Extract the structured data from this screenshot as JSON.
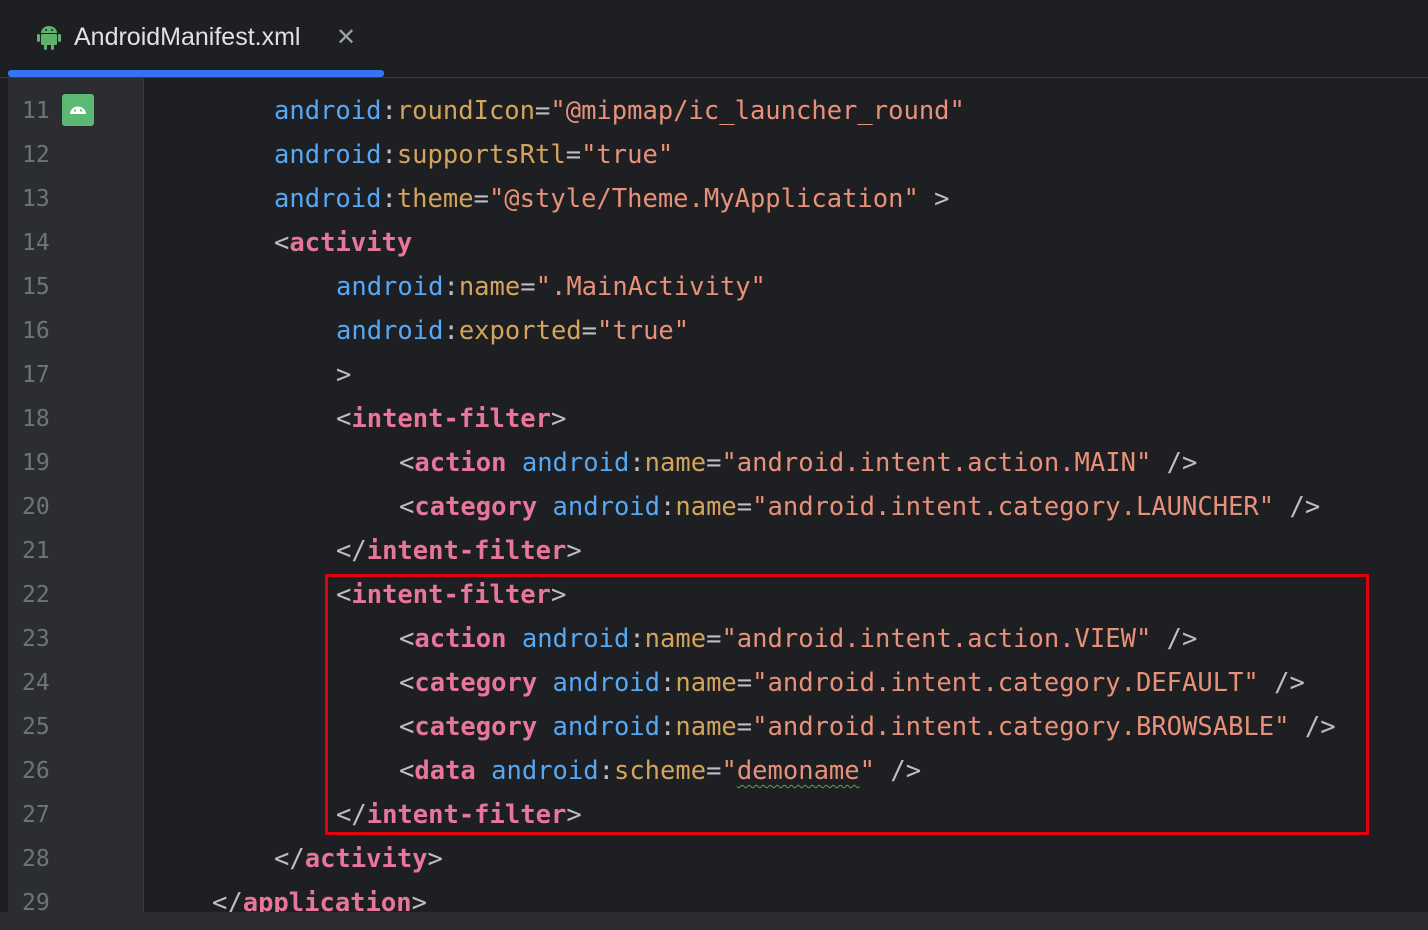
{
  "tab": {
    "title": "AndroidManifest.xml",
    "close_glyph": "✕",
    "icon": "android-icon"
  },
  "colors": {
    "namespace": "#56a8f5",
    "attribute": "#d3a45c",
    "string": "#e8917a",
    "tag": "#e8769b",
    "punctuation": "#bcbec4",
    "highlight_box": "#e00010"
  },
  "lines": [
    {
      "num": "11",
      "indent": 2,
      "tokens": [
        [
          "ns",
          "android"
        ],
        [
          "pu",
          ":"
        ],
        [
          "at",
          "roundIcon"
        ],
        [
          "pu",
          "="
        ],
        [
          "st",
          "\"@mipmap/ic_launcher_round\""
        ]
      ]
    },
    {
      "num": "12",
      "indent": 2,
      "tokens": [
        [
          "ns",
          "android"
        ],
        [
          "pu",
          ":"
        ],
        [
          "at",
          "supportsRtl"
        ],
        [
          "pu",
          "="
        ],
        [
          "st",
          "\"true\""
        ]
      ]
    },
    {
      "num": "13",
      "indent": 2,
      "tokens": [
        [
          "ns",
          "android"
        ],
        [
          "pu",
          ":"
        ],
        [
          "at",
          "theme"
        ],
        [
          "pu",
          "="
        ],
        [
          "st",
          "\"@style/Theme.MyApplication\""
        ],
        [
          "pu",
          " >"
        ]
      ]
    },
    {
      "num": "14",
      "indent": 2,
      "tokens": [
        [
          "pu",
          "<"
        ],
        [
          "tn",
          "activity"
        ]
      ]
    },
    {
      "num": "15",
      "indent": 3,
      "tokens": [
        [
          "ns",
          "android"
        ],
        [
          "pu",
          ":"
        ],
        [
          "at",
          "name"
        ],
        [
          "pu",
          "="
        ],
        [
          "st",
          "\".MainActivity\""
        ]
      ]
    },
    {
      "num": "16",
      "indent": 3,
      "tokens": [
        [
          "ns",
          "android"
        ],
        [
          "pu",
          ":"
        ],
        [
          "at",
          "exported"
        ],
        [
          "pu",
          "="
        ],
        [
          "st",
          "\"true\""
        ]
      ]
    },
    {
      "num": "17",
      "indent": 3,
      "tokens": [
        [
          "pu",
          ">"
        ]
      ]
    },
    {
      "num": "18",
      "indent": 3,
      "tokens": [
        [
          "pu",
          "<"
        ],
        [
          "tn",
          "intent-filter"
        ],
        [
          "pu",
          ">"
        ]
      ]
    },
    {
      "num": "19",
      "indent": 4,
      "tokens": [
        [
          "pu",
          "<"
        ],
        [
          "tn",
          "action"
        ],
        [
          "pu",
          " "
        ],
        [
          "ns",
          "android"
        ],
        [
          "pu",
          ":"
        ],
        [
          "at",
          "name"
        ],
        [
          "pu",
          "="
        ],
        [
          "st",
          "\"android.intent.action.MAIN\""
        ],
        [
          "pu",
          " />"
        ]
      ]
    },
    {
      "num": "20",
      "indent": 4,
      "tokens": [
        [
          "pu",
          "<"
        ],
        [
          "tn",
          "category"
        ],
        [
          "pu",
          " "
        ],
        [
          "ns",
          "android"
        ],
        [
          "pu",
          ":"
        ],
        [
          "at",
          "name"
        ],
        [
          "pu",
          "="
        ],
        [
          "st",
          "\"android.intent.category.LAUNCHER\""
        ],
        [
          "pu",
          " />"
        ]
      ]
    },
    {
      "num": "21",
      "indent": 3,
      "tokens": [
        [
          "pu",
          "</"
        ],
        [
          "tn",
          "intent-filter"
        ],
        [
          "pu",
          ">"
        ]
      ]
    },
    {
      "num": "22",
      "indent": 3,
      "tokens": [
        [
          "pu",
          "<"
        ],
        [
          "tn",
          "intent-filter"
        ],
        [
          "pu",
          ">"
        ]
      ]
    },
    {
      "num": "23",
      "indent": 4,
      "tokens": [
        [
          "pu",
          "<"
        ],
        [
          "tn",
          "action"
        ],
        [
          "pu",
          " "
        ],
        [
          "ns",
          "android"
        ],
        [
          "pu",
          ":"
        ],
        [
          "at",
          "name"
        ],
        [
          "pu",
          "="
        ],
        [
          "st",
          "\"android.intent.action.VIEW\""
        ],
        [
          "pu",
          " />"
        ]
      ]
    },
    {
      "num": "24",
      "indent": 4,
      "tokens": [
        [
          "pu",
          "<"
        ],
        [
          "tn",
          "category"
        ],
        [
          "pu",
          " "
        ],
        [
          "ns",
          "android"
        ],
        [
          "pu",
          ":"
        ],
        [
          "at",
          "name"
        ],
        [
          "pu",
          "="
        ],
        [
          "st",
          "\"android.intent.category.DEFAULT\""
        ],
        [
          "pu",
          " />"
        ]
      ]
    },
    {
      "num": "25",
      "indent": 4,
      "tokens": [
        [
          "pu",
          "<"
        ],
        [
          "tn",
          "category"
        ],
        [
          "pu",
          " "
        ],
        [
          "ns",
          "android"
        ],
        [
          "pu",
          ":"
        ],
        [
          "at",
          "name"
        ],
        [
          "pu",
          "="
        ],
        [
          "st",
          "\"android.intent.category.BROWSABLE\""
        ],
        [
          "pu",
          " />"
        ]
      ]
    },
    {
      "num": "26",
      "indent": 4,
      "tokens": [
        [
          "pu",
          "<"
        ],
        [
          "tn",
          "data"
        ],
        [
          "pu",
          " "
        ],
        [
          "ns",
          "android"
        ],
        [
          "pu",
          ":"
        ],
        [
          "at",
          "scheme"
        ],
        [
          "pu",
          "="
        ],
        [
          "st",
          "\""
        ],
        [
          "sq",
          "demoname"
        ],
        [
          "st",
          "\""
        ],
        [
          "pu",
          " />"
        ]
      ]
    },
    {
      "num": "27",
      "indent": 3,
      "tokens": [
        [
          "pu",
          "</"
        ],
        [
          "tn",
          "intent-filter"
        ],
        [
          "pu",
          ">"
        ]
      ]
    },
    {
      "num": "28",
      "indent": 2,
      "tokens": [
        [
          "pu",
          "</"
        ],
        [
          "tn",
          "activity"
        ],
        [
          "pu",
          ">"
        ]
      ]
    },
    {
      "num": "29",
      "indent": 1,
      "tokens": [
        [
          "pu",
          "</"
        ],
        [
          "tn",
          "application"
        ],
        [
          "pu",
          ">"
        ]
      ]
    }
  ]
}
